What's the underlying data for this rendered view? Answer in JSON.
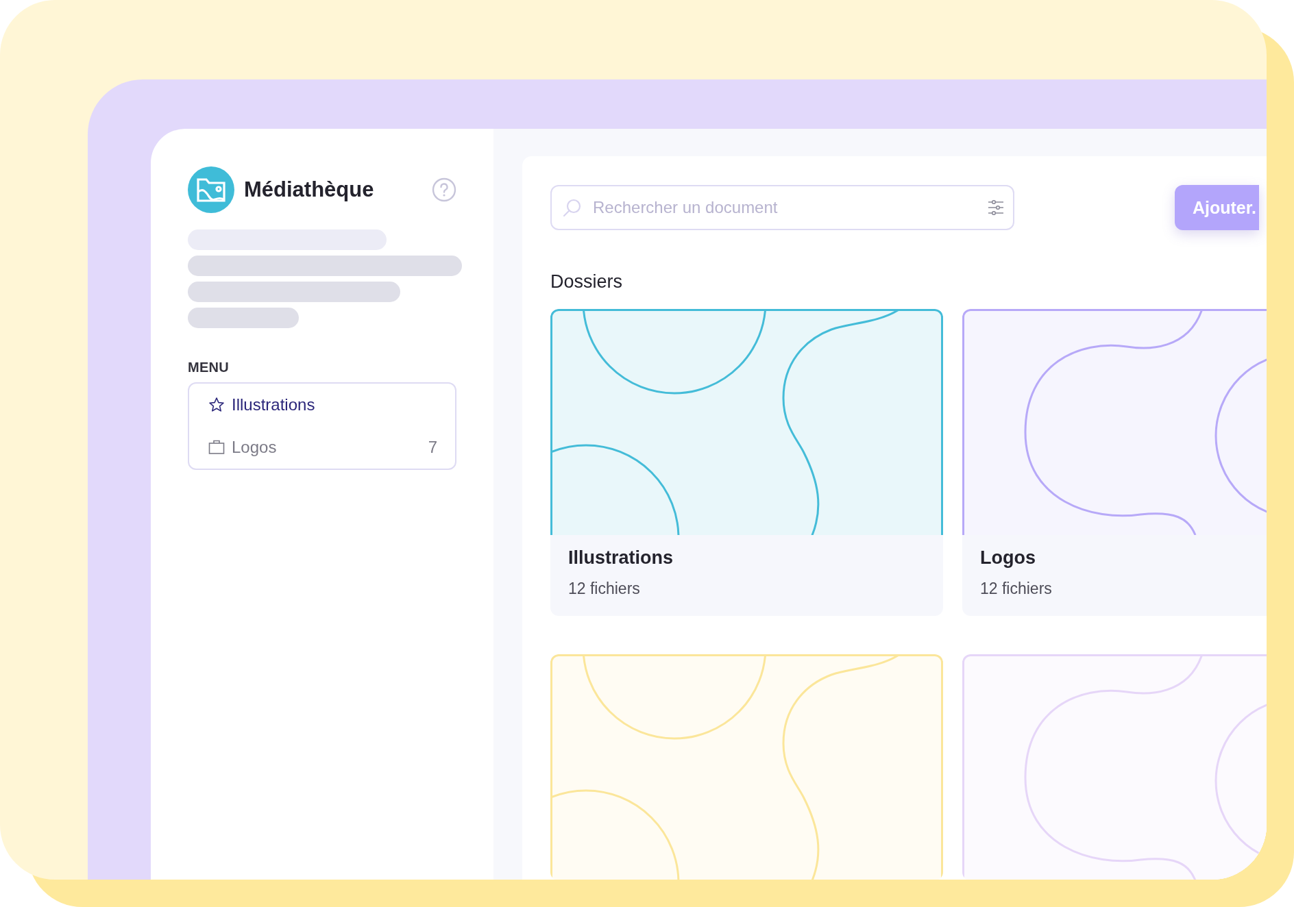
{
  "app": {
    "title": "Médiathèque"
  },
  "menu": {
    "heading": "MENU",
    "items": [
      {
        "kind": "favorite",
        "label": "Illustrations",
        "selected": true
      },
      {
        "kind": "folder",
        "label": "Logos",
        "count": "7",
        "selected": false
      }
    ]
  },
  "search": {
    "placeholder": "Rechercher un document"
  },
  "add_button": "Ajouter.",
  "section_title": "Dossiers",
  "folders": [
    {
      "kind": "circles",
      "color": "#44bcd8",
      "name": "Illustrations",
      "files": "12 fichiers"
    },
    {
      "kind": "blobs",
      "color": "#b7a9f8",
      "name": "Logos",
      "files": "12 fichiers"
    },
    {
      "kind": "circles",
      "color": "#fbe69a"
    },
    {
      "kind": "blobs",
      "color": "#e6d6f8"
    }
  ]
}
